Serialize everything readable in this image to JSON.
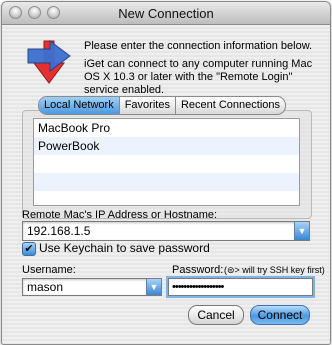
{
  "window": {
    "title": "New Connection"
  },
  "info": {
    "line1": "Please enter the connection information below.",
    "line2": "iGet can connect to any computer running Mac OS X 10.3 or later with the \"Remote Login\" service enabled."
  },
  "tabs": [
    {
      "label": "Local Network",
      "selected": true
    },
    {
      "label": "Favorites",
      "selected": false
    },
    {
      "label": "Recent Connections",
      "selected": false
    }
  ],
  "computers": [
    "MacBook Pro",
    "PowerBook"
  ],
  "host": {
    "label": "Remote Mac's IP Address or Hostname:",
    "value": "192.168.1.5"
  },
  "keychain": {
    "label": "Use Keychain to save password",
    "checked": true
  },
  "username": {
    "label": "Username:",
    "value": "mason"
  },
  "password": {
    "label": "Password:",
    "hint": "(⊜> will try SSH key first)",
    "masked": "••••••••••••••••••"
  },
  "buttons": {
    "cancel": "Cancel",
    "connect": "Connect"
  },
  "colors": {
    "accent": "#4a99e0",
    "selection": "#edf3fe",
    "logo_red": "#e4312f",
    "logo_blue": "#3c6fd0"
  }
}
